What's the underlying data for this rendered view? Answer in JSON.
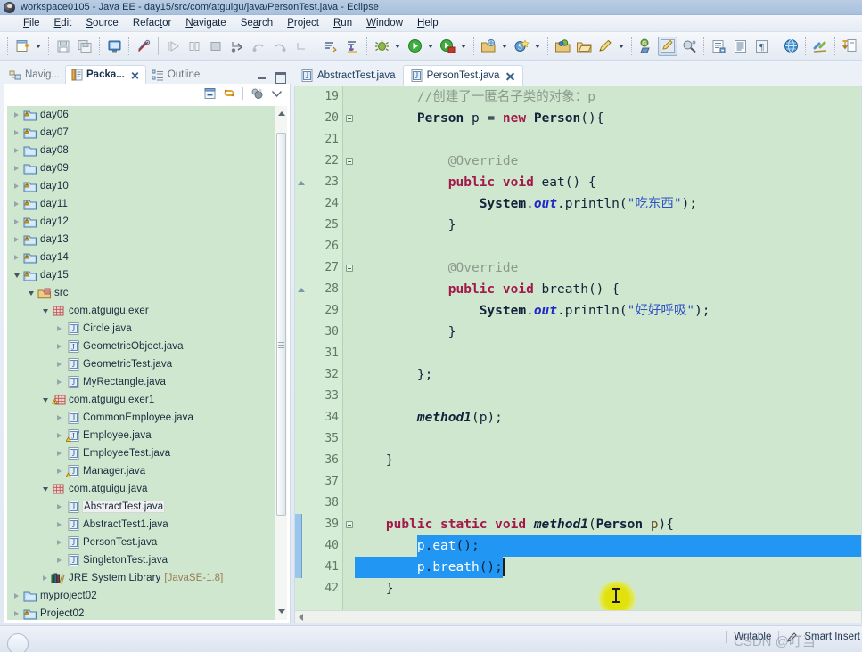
{
  "window": {
    "title": "workspace0105 - Java EE - day15/src/com/atguigu/java/PersonTest.java - Eclipse",
    "app_icon": "eclipse-icon"
  },
  "menu": {
    "items": [
      {
        "label": "File",
        "mnemonic": "F"
      },
      {
        "label": "Edit",
        "mnemonic": "E"
      },
      {
        "label": "Source",
        "mnemonic": "S"
      },
      {
        "label": "Refactor",
        "mnemonic": "t"
      },
      {
        "label": "Navigate",
        "mnemonic": "N"
      },
      {
        "label": "Search",
        "mnemonic": "a"
      },
      {
        "label": "Project",
        "mnemonic": "P"
      },
      {
        "label": "Run",
        "mnemonic": "R"
      },
      {
        "label": "Window",
        "mnemonic": "W"
      },
      {
        "label": "Help",
        "mnemonic": "H"
      }
    ]
  },
  "toolbar": {
    "buttons": [
      "new-wizard-icon",
      "new-dropdown-arrow",
      "save-icon",
      "save-all-icon",
      "print-icon",
      "toggle-breakpoint-icon",
      "resume-icon",
      "suspend-icon",
      "terminate-icon",
      "step-into-icon",
      "step-over-icon",
      "step-return-icon",
      "drop-to-frame-icon",
      "next-annotation-icon",
      "previous-annotation-icon",
      "debug-icon",
      "debug-dropdown-arrow",
      "run-icon",
      "run-dropdown-arrow",
      "coverage-icon",
      "coverage-dropdown-arrow",
      "new-java-project-icon",
      "new-project-dropdown-arrow",
      "new-class-icon",
      "new-class-dropdown-arrow",
      "open-type-icon",
      "open-task-icon",
      "edit-icon",
      "edit-dropdown-arrow",
      "toggle-mark-occurrences-icon",
      "java-editor-icon",
      "search-icon",
      "open-resource-icon",
      "show-whitespace-icon",
      "pilcrow-icon",
      "open-web-browser-icon",
      "link-icon",
      "previous-edit-icon",
      "previous-dropdown-arrow",
      "next-edit-icon",
      "next-dropdown-arrow"
    ]
  },
  "left_panel": {
    "tabs": [
      {
        "label": "Navig...",
        "icon": "navigator-icon",
        "active": false,
        "closable": false
      },
      {
        "label": "Packa...",
        "icon": "package-explorer-icon",
        "active": true,
        "closable": true
      },
      {
        "label": "Outline",
        "icon": "outline-icon",
        "active": false,
        "closable": false
      }
    ],
    "view_actions": [
      "collapse-all-icon",
      "link-with-editor-icon",
      "view-menu-icon",
      "view-dropdown-icon"
    ],
    "window_actions": [
      "minimize-icon",
      "maximize-icon"
    ],
    "tree": [
      {
        "label": "day06",
        "icon": "java-project-warning-icon",
        "indent": 0,
        "state": "closed"
      },
      {
        "label": "day07",
        "icon": "java-project-warning-icon",
        "indent": 0,
        "state": "closed"
      },
      {
        "label": "day08",
        "icon": "project-icon",
        "indent": 0,
        "state": "closed"
      },
      {
        "label": "day09",
        "icon": "project-icon",
        "indent": 0,
        "state": "closed"
      },
      {
        "label": "day10",
        "icon": "java-project-warning-icon",
        "indent": 0,
        "state": "closed"
      },
      {
        "label": "day11",
        "icon": "java-project-warning-icon",
        "indent": 0,
        "state": "closed"
      },
      {
        "label": "day12",
        "icon": "java-project-warning-icon",
        "indent": 0,
        "state": "closed"
      },
      {
        "label": "day13",
        "icon": "java-project-warning-icon",
        "indent": 0,
        "state": "closed"
      },
      {
        "label": "day14",
        "icon": "java-project-warning-icon",
        "indent": 0,
        "state": "closed"
      },
      {
        "label": "day15",
        "icon": "java-project-warning-icon",
        "indent": 0,
        "state": "open"
      },
      {
        "label": "src",
        "icon": "source-folder-icon",
        "indent": 1,
        "state": "open"
      },
      {
        "label": "com.atguigu.exer",
        "icon": "package-icon",
        "indent": 2,
        "state": "open"
      },
      {
        "label": "Circle.java",
        "icon": "java-file-icon",
        "indent": 3,
        "state": "closed"
      },
      {
        "label": "GeometricObject.java",
        "icon": "java-abstract-file-icon",
        "indent": 3,
        "state": "closed"
      },
      {
        "label": "GeometricTest.java",
        "icon": "java-file-icon",
        "indent": 3,
        "state": "closed"
      },
      {
        "label": "MyRectangle.java",
        "icon": "java-file-icon",
        "indent": 3,
        "state": "closed"
      },
      {
        "label": "com.atguigu.exer1",
        "icon": "package-warning-icon",
        "indent": 2,
        "state": "open"
      },
      {
        "label": "CommonEmployee.java",
        "icon": "java-file-icon",
        "indent": 3,
        "state": "closed"
      },
      {
        "label": "Employee.java",
        "icon": "java-abstract-warning-file-icon",
        "indent": 3,
        "state": "closed"
      },
      {
        "label": "EmployeeTest.java",
        "icon": "java-file-icon",
        "indent": 3,
        "state": "closed"
      },
      {
        "label": "Manager.java",
        "icon": "java-warning-file-icon",
        "indent": 3,
        "state": "closed"
      },
      {
        "label": "com.atguigu.java",
        "icon": "package-icon",
        "indent": 2,
        "state": "open"
      },
      {
        "label": "AbstractTest.java",
        "icon": "java-file-icon",
        "indent": 3,
        "state": "closed",
        "selected": true
      },
      {
        "label": "AbstractTest1.java",
        "icon": "java-file-icon",
        "indent": 3,
        "state": "closed"
      },
      {
        "label": "PersonTest.java",
        "icon": "java-file-icon",
        "indent": 3,
        "state": "closed"
      },
      {
        "label": "SingletonTest.java",
        "icon": "java-file-icon",
        "indent": 3,
        "state": "closed"
      },
      {
        "label": "JRE System Library",
        "sublabel": "[JavaSE-1.8]",
        "icon": "library-icon",
        "indent": 2,
        "state": "closed"
      },
      {
        "label": "myproject02",
        "icon": "project-icon",
        "indent": 0,
        "state": "closed"
      },
      {
        "label": "Project02",
        "icon": "java-project-warning-icon",
        "indent": 0,
        "state": "closed"
      }
    ]
  },
  "editor": {
    "tabs": [
      {
        "label": "AbstractTest.java",
        "icon": "java-file-icon",
        "active": false,
        "closable": false
      },
      {
        "label": "PersonTest.java",
        "icon": "java-file-icon",
        "active": true,
        "closable": true
      }
    ],
    "first_line": 19,
    "lines": [
      {
        "n": 19,
        "fold": "",
        "marker": "",
        "text": "        //创建了一匿名子类的对象：p",
        "kind": "comment"
      },
      {
        "n": 20,
        "fold": "collapse",
        "marker": "",
        "text": "        Person p = new Person(){",
        "kind": "code"
      },
      {
        "n": 21,
        "fold": "",
        "marker": "",
        "text": "",
        "kind": "code"
      },
      {
        "n": 22,
        "fold": "collapse",
        "marker": "",
        "text": "            @Override",
        "kind": "annotation"
      },
      {
        "n": 23,
        "fold": "",
        "marker": "override",
        "text": "            public void eat() {",
        "kind": "code"
      },
      {
        "n": 24,
        "fold": "",
        "marker": "",
        "text": "                System.out.println(\"吃东西\");",
        "kind": "code"
      },
      {
        "n": 25,
        "fold": "",
        "marker": "",
        "text": "            }",
        "kind": "code"
      },
      {
        "n": 26,
        "fold": "",
        "marker": "",
        "text": "",
        "kind": "code"
      },
      {
        "n": 27,
        "fold": "collapse",
        "marker": "",
        "text": "            @Override",
        "kind": "annotation"
      },
      {
        "n": 28,
        "fold": "",
        "marker": "override",
        "text": "            public void breath() {",
        "kind": "code"
      },
      {
        "n": 29,
        "fold": "",
        "marker": "",
        "text": "                System.out.println(\"好好呼吸\");",
        "kind": "code"
      },
      {
        "n": 30,
        "fold": "",
        "marker": "",
        "text": "            }",
        "kind": "code"
      },
      {
        "n": 31,
        "fold": "",
        "marker": "",
        "text": "",
        "kind": "code"
      },
      {
        "n": 32,
        "fold": "",
        "marker": "",
        "text": "        };",
        "kind": "code"
      },
      {
        "n": 33,
        "fold": "",
        "marker": "",
        "text": "",
        "kind": "code"
      },
      {
        "n": 34,
        "fold": "",
        "marker": "",
        "text": "        method1(p);",
        "kind": "code"
      },
      {
        "n": 35,
        "fold": "",
        "marker": "",
        "text": "",
        "kind": "code"
      },
      {
        "n": 36,
        "fold": "",
        "marker": "",
        "text": "    }",
        "kind": "code"
      },
      {
        "n": 37,
        "fold": "",
        "marker": "",
        "text": "",
        "kind": "code"
      },
      {
        "n": 38,
        "fold": "",
        "marker": "",
        "text": "",
        "kind": "code"
      },
      {
        "n": 39,
        "fold": "collapse",
        "marker": "",
        "text": "    public static void method1(Person p){",
        "kind": "code"
      },
      {
        "n": 40,
        "fold": "",
        "marker": "",
        "text": "        p.eat();",
        "kind": "code",
        "selected": true
      },
      {
        "n": 41,
        "fold": "",
        "marker": "",
        "text": "        p.breath();",
        "kind": "code",
        "selected": true
      },
      {
        "n": 42,
        "fold": "",
        "marker": "",
        "text": "    }",
        "kind": "code"
      }
    ],
    "selection": {
      "from_line": 40,
      "to_line": 41,
      "color": "#2196f3",
      "text_color": "#ffffff"
    },
    "colors": {
      "background": "#cfe7cf",
      "gutter": "#d7ecd7",
      "keyword": "#a3194a",
      "comment": "#8c9a8c",
      "string": "#2f52c8",
      "static_field": "#2026c8",
      "parameter": "#6b4a1f",
      "line_number": "#5d7a64"
    }
  },
  "statusbar": {
    "writable": "Writable",
    "insert_mode": "Smart Insert",
    "watermark": "CSDN @叮当",
    "pen_icon": "writing-mode-icon"
  }
}
